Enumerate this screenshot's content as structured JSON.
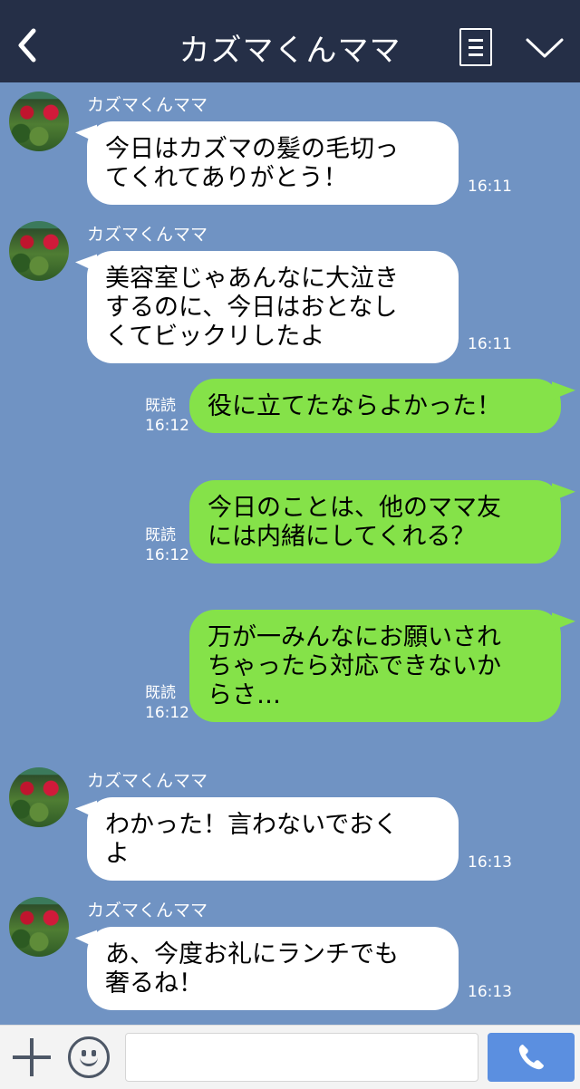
{
  "header": {
    "title": "カズマくんママ",
    "back_icon": "chevron-left-icon",
    "menu_icon": "menu-icon",
    "collapse_icon": "chevron-down-icon"
  },
  "messages": [
    {
      "side": "left",
      "sender": "カズマくんママ",
      "lines": [
        "今日はカズマの髪の毛切っ",
        "てくれてありがとう！"
      ],
      "time": "16:11"
    },
    {
      "side": "left",
      "sender": "カズマくんママ",
      "lines": [
        "美容室じゃあんなに大泣き",
        "するのに、今日はおとなし",
        "くてビックリしたよ"
      ],
      "time": "16:11"
    },
    {
      "side": "right",
      "read": "既読",
      "lines": [
        "役に立てたならよかった！"
      ],
      "time": "16:12"
    },
    {
      "side": "right",
      "read": "既読",
      "lines": [
        "今日のことは、他のママ友",
        "には内緒にしてくれる？"
      ],
      "time": "16:12"
    },
    {
      "side": "right",
      "read": "既読",
      "lines": [
        "万が一みんなにお願いされ",
        "ちゃったら対応できないか",
        "らさ…"
      ],
      "time": "16:12"
    },
    {
      "side": "left",
      "sender": "カズマくんママ",
      "lines": [
        "わかった！言わないでおく",
        "よ"
      ],
      "time": "16:13"
    },
    {
      "side": "left",
      "sender": "カズマくんママ",
      "lines": [
        "あ、今度お礼にランチでも",
        "奢るね！"
      ],
      "time": "16:13"
    }
  ],
  "footer": {
    "input_placeholder": "",
    "plus_icon": "plus-icon",
    "emoji_icon": "smiley-icon",
    "call_icon": "phone-icon"
  },
  "colors": {
    "background": "#7093c3",
    "header": "#252f47",
    "left_bubble": "#ffffff",
    "right_bubble": "#85e249",
    "call_button": "#5b8fe0"
  }
}
